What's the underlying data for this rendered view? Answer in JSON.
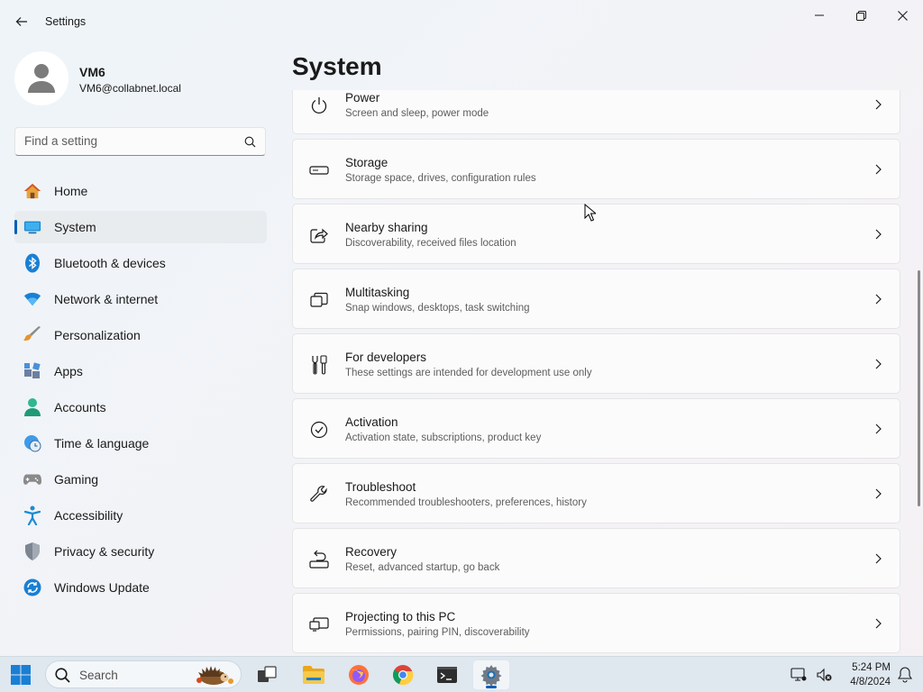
{
  "window": {
    "title": "Settings"
  },
  "user": {
    "name": "VM6",
    "email": "VM6@collabnet.local"
  },
  "search": {
    "placeholder": "Find a setting"
  },
  "sidebar": {
    "items": [
      {
        "label": "Home",
        "icon": "home-icon"
      },
      {
        "label": "System",
        "icon": "system-icon",
        "selected": true
      },
      {
        "label": "Bluetooth & devices",
        "icon": "bluetooth-icon"
      },
      {
        "label": "Network & internet",
        "icon": "wifi-icon"
      },
      {
        "label": "Personalization",
        "icon": "brush-icon"
      },
      {
        "label": "Apps",
        "icon": "apps-icon"
      },
      {
        "label": "Accounts",
        "icon": "person-icon"
      },
      {
        "label": "Time & language",
        "icon": "globe-clock-icon"
      },
      {
        "label": "Gaming",
        "icon": "gamepad-icon"
      },
      {
        "label": "Accessibility",
        "icon": "accessibility-icon"
      },
      {
        "label": "Privacy & security",
        "icon": "shield-icon"
      },
      {
        "label": "Windows Update",
        "icon": "update-icon"
      }
    ]
  },
  "main": {
    "title": "System",
    "cards": [
      {
        "title": "Power",
        "description": "Screen and sleep, power mode",
        "icon": "power-icon"
      },
      {
        "title": "Storage",
        "description": "Storage space, drives, configuration rules",
        "icon": "storage-icon"
      },
      {
        "title": "Nearby sharing",
        "description": "Discoverability, received files location",
        "icon": "share-icon"
      },
      {
        "title": "Multitasking",
        "description": "Snap windows, desktops, task switching",
        "icon": "multitasking-icon"
      },
      {
        "title": "For developers",
        "description": "These settings are intended for development use only",
        "icon": "developer-tools-icon"
      },
      {
        "title": "Activation",
        "description": "Activation state, subscriptions, product key",
        "icon": "check-circle-icon"
      },
      {
        "title": "Troubleshoot",
        "description": "Recommended troubleshooters, preferences, history",
        "icon": "wrench-icon"
      },
      {
        "title": "Recovery",
        "description": "Reset, advanced startup, go back",
        "icon": "recovery-icon"
      },
      {
        "title": "Projecting to this PC",
        "description": "Permissions, pairing PIN, discoverability",
        "icon": "projecting-icon"
      }
    ]
  },
  "taskbar": {
    "search_label": "Search",
    "apps": [
      "task-view-icon",
      "file-explorer-icon",
      "firefox-icon",
      "chrome-icon",
      "terminal-icon",
      "settings-icon"
    ],
    "time": "5:24 PM",
    "date": "4/8/2024"
  },
  "colors": {
    "accent": "#005fb8",
    "background": "#f3f3f3"
  }
}
